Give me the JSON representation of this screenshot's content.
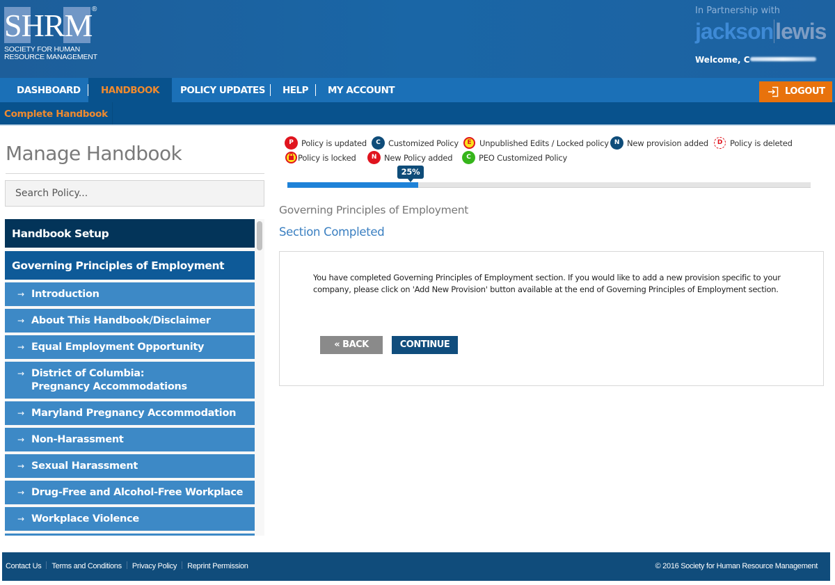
{
  "header": {
    "logo": {
      "letters": "SHRM",
      "registered": "®",
      "subtitle_line1": "SOCIETY FOR HUMAN",
      "subtitle_line2": "RESOURCE MANAGEMENT"
    },
    "partner_label": "In Partnership with",
    "partner_name_part1": "jackson",
    "partner_name_part2": "lewis",
    "welcome": "Welcome, C"
  },
  "nav": {
    "items": [
      {
        "label": "DASHBOARD",
        "active": false
      },
      {
        "label": "HANDBOOK",
        "active": true
      },
      {
        "label": "POLICY UPDATES",
        "active": false
      },
      {
        "label": "HELP",
        "active": false
      },
      {
        "label": "MY ACCOUNT",
        "active": false
      }
    ],
    "logout_label": "LOGOUT",
    "logout_icon": "sign-out-icon"
  },
  "subnav": {
    "items": [
      {
        "label": "Complete Handbook"
      }
    ]
  },
  "sidebar": {
    "title": "Manage Handbook",
    "search_placeholder": "Search Policy...",
    "search_value": "",
    "setup_label": "Handbook Setup",
    "section_label": "Governing Principles of Employment",
    "arrow_glyph": "→",
    "policies": [
      "Introduction",
      "About This Handbook/Disclaimer",
      "Equal Employment Opportunity",
      "District of Columbia: Pregnancy Accommodations",
      "Maryland Pregnancy Accommodation",
      "Non-Harassment",
      "Sexual Harassment",
      "Drug-Free and Alcohol-Free Workplace",
      "Workplace Violence"
    ]
  },
  "legend": {
    "items": [
      {
        "badge": "P",
        "label": "Policy is updated",
        "icon": "policy-updated-badge-icon",
        "color": "#e0141e"
      },
      {
        "badge": "C",
        "label": "Customized Policy",
        "icon": "customized-policy-badge-icon",
        "color": "#0e4c79"
      },
      {
        "badge": "E",
        "label": "Unpublished Edits / Locked policy",
        "icon": "unpublished-edits-badge-icon",
        "color": "#fbe31b"
      },
      {
        "badge": "N",
        "label": "New provision added",
        "icon": "new-provision-badge-icon",
        "color": "#0e4c79"
      },
      {
        "badge": "D",
        "label": "Policy is deleted",
        "icon": "policy-deleted-badge-icon",
        "color": "#e0141e"
      },
      {
        "badge": "🔒",
        "label": "Policy is locked",
        "icon": "policy-locked-badge-icon",
        "color": "#fbe31b"
      },
      {
        "badge": "N",
        "label": "New Policy added",
        "icon": "new-policy-badge-icon",
        "color": "#e0141e"
      },
      {
        "badge": "C",
        "label": "PEO Customized Policy",
        "icon": "peo-customized-badge-icon",
        "color": "#36b51b"
      }
    ]
  },
  "progress": {
    "percent": 25,
    "label": "25%"
  },
  "content": {
    "breadcrumb": "Governing Principles of Employment",
    "status": "Section Completed",
    "message": "You have completed Governing Principles of Employment section. If you would like to add a new provision specific to your company, please click on 'Add New Provision' button available at the end of Governing Principles of Employment section.",
    "back_label": "« BACK",
    "continue_label": "CONTINUE"
  },
  "footer": {
    "links": [
      "Contact Us",
      "Terms and Conditions",
      "Privacy Policy",
      "Reprint Permission"
    ],
    "copyright": "© 2016 Society for Human Resource Management"
  },
  "colors": {
    "brand_blue": "#1b70b7",
    "dark_blue": "#08528d",
    "accent_orange": "#e8720c",
    "link_orange": "#f08a2e",
    "progress_blue": "#1e82d8"
  }
}
